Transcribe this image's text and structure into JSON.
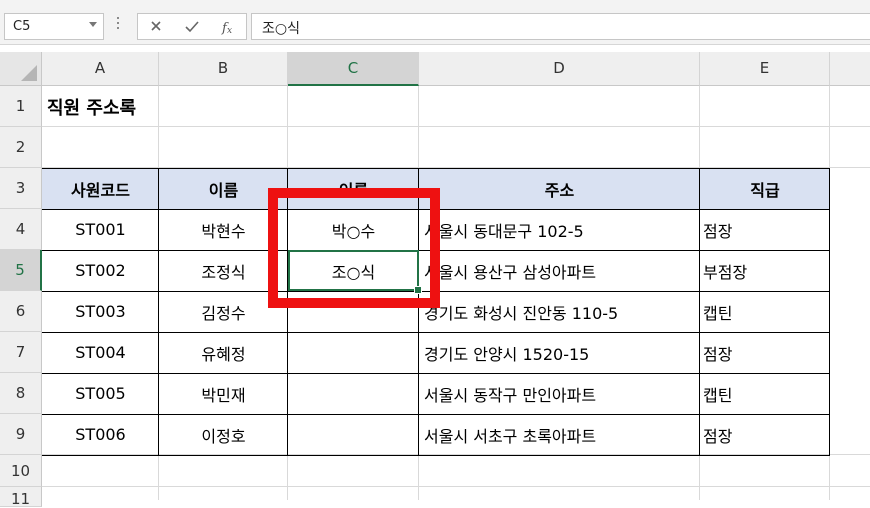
{
  "formula_bar": {
    "name_box": "C5",
    "cancel_icon": "cancel-icon",
    "enter_icon": "enter-icon",
    "function_icon": "fx-icon",
    "formula": "조○식"
  },
  "columns": [
    "A",
    "B",
    "C",
    "D",
    "E"
  ],
  "selected_column": "C",
  "rows": [
    "1",
    "2",
    "3",
    "4",
    "5",
    "6",
    "7",
    "8",
    "9",
    "10",
    "11"
  ],
  "selected_row": "5",
  "sheet": {
    "title": "직원 주소록",
    "headers": [
      "사원코드",
      "이름",
      "이름",
      "주소",
      "직급"
    ],
    "records": [
      {
        "code": "ST001",
        "name": "박현수",
        "masked": "박○수",
        "address": "서울시 동대문구 102-5",
        "rank": "점장"
      },
      {
        "code": "ST002",
        "name": "조정식",
        "masked": "조○식",
        "address": "서울시 용산구 삼성아파트",
        "rank": "부점장"
      },
      {
        "code": "ST003",
        "name": "김정수",
        "masked": "",
        "address": "경기도 화성시 진안동 110-5",
        "rank": "캡틴"
      },
      {
        "code": "ST004",
        "name": "유혜정",
        "masked": "",
        "address": "경기도 안양시 1520-15",
        "rank": "점장"
      },
      {
        "code": "ST005",
        "name": "박민재",
        "masked": "",
        "address": "서울시 동작구 만인아파트",
        "rank": "캡틴"
      },
      {
        "code": "ST006",
        "name": "이정호",
        "masked": "",
        "address": "서울시 서초구 초록아파트",
        "rank": "점장"
      }
    ]
  },
  "colors": {
    "header_fill": "#d9e1f2",
    "selection": "#217346",
    "highlight_box": "#ee1111"
  }
}
